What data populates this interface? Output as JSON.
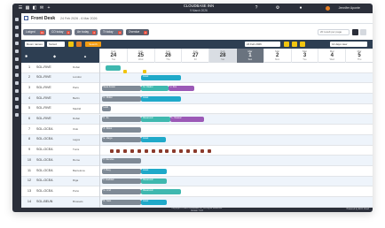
{
  "app": {
    "title": "CLOUDBASE INN",
    "subtitle": "9 March 2026",
    "user": "Jennifer Aponte"
  },
  "header": {
    "title": "Front Desk",
    "date_range": "24 Feb 2026 - 6 Mar 2026"
  },
  "filter_chips": [
    {
      "label": "Lodged",
      "count": "31",
      "dark": false
    },
    {
      "label": "CO today",
      "count": "3",
      "dark": false
    },
    {
      "label": "Arr today",
      "count": "4",
      "dark": false
    },
    {
      "label": "Tt today",
      "count": "3",
      "dark": false
    },
    {
      "label": "Overdue",
      "count": "2",
      "dark": true
    }
  ],
  "search_room_placeholder": "20 result per page",
  "toolbar": {
    "room_select": "Room names",
    "type_select": "Sorted",
    "search_button": "Search",
    "date_value": "24 Feb 2026",
    "days_select": "14 days view"
  },
  "grid_header": {
    "col_room": "#",
    "col_name": "",
    "col_type": ""
  },
  "days": [
    {
      "month": "Feb",
      "day": "24",
      "weekday": "Tue",
      "weekend": false,
      "today": false
    },
    {
      "month": "Feb",
      "day": "25",
      "weekday": "Wed",
      "weekend": false,
      "today": false
    },
    {
      "month": "Feb",
      "day": "26",
      "weekday": "Thu",
      "weekend": false,
      "today": false
    },
    {
      "month": "Feb",
      "day": "27",
      "weekday": "Fri",
      "weekend": false,
      "today": false
    },
    {
      "month": "Feb",
      "day": "28",
      "weekday": "Sat",
      "weekend": true,
      "today": false
    },
    {
      "month": "Mar",
      "day": "1",
      "weekday": "Sun",
      "weekend": true,
      "today": true
    },
    {
      "month": "Mar",
      "day": "2",
      "weekday": "Mon",
      "weekend": false,
      "today": false
    },
    {
      "month": "Mar",
      "day": "3",
      "weekday": "Tue",
      "weekend": false,
      "today": false
    },
    {
      "month": "Mar",
      "day": "4",
      "weekday": "Wed",
      "weekend": false,
      "today": false
    },
    {
      "month": "Mar",
      "day": "5",
      "weekday": "Thu",
      "weekend": false,
      "today": false
    }
  ],
  "rooms": [
    {
      "num": "1",
      "name": "SGL-RIVE",
      "type": "Dubai"
    },
    {
      "num": "2",
      "name": "SGL-RIVE",
      "type": "London"
    },
    {
      "num": "3",
      "name": "SGL-RIVE",
      "type": "Paris"
    },
    {
      "num": "4",
      "name": "SGL-RIVE",
      "type": "Berlin"
    },
    {
      "num": "5",
      "name": "SGL-RIVE",
      "type": "Madrid"
    },
    {
      "num": "6",
      "name": "SGL-RIVE",
      "type": "Dubai"
    },
    {
      "num": "7",
      "name": "SGL-OCEA",
      "type": "Oslo"
    },
    {
      "num": "8",
      "name": "SGL-OCEA",
      "type": "Lagos"
    },
    {
      "num": "9",
      "name": "SGL-OCEA",
      "type": "Tunis"
    },
    {
      "num": "10",
      "name": "SGL-OCEA",
      "type": "Rome"
    },
    {
      "num": "11",
      "name": "SGL-OCEA",
      "type": "Barcelona"
    },
    {
      "num": "12",
      "name": "SGL-OCEA",
      "type": "Riga"
    },
    {
      "num": "13",
      "name": "SGL-OCEA",
      "type": "Porto"
    },
    {
      "num": "14",
      "name": "SGL-BEUN",
      "type": "Brussels"
    }
  ],
  "bookings": [
    {
      "room": 0,
      "start": 0.2,
      "len": 0.55,
      "color": "teal",
      "label": ""
    },
    {
      "room": 1,
      "start": 1.5,
      "len": 1.45,
      "color": "cyan",
      "label": "Hotel"
    },
    {
      "room": 2,
      "start": 0.05,
      "len": 1.45,
      "color": "gray",
      "label": "Sara Foster"
    },
    {
      "room": 2,
      "start": 1.5,
      "len": 1.0,
      "color": "teal",
      "label": "M. Okafor"
    },
    {
      "room": 2,
      "start": 2.5,
      "len": 0.95,
      "color": "purple",
      "label": "J. Kim"
    },
    {
      "room": 3,
      "start": 0.05,
      "len": 1.45,
      "color": "gray",
      "label": "D. Müller"
    },
    {
      "room": 3,
      "start": 1.5,
      "len": 1.45,
      "color": "cyan",
      "label": "Hotel"
    },
    {
      "room": 4,
      "start": 0.05,
      "len": 0.35,
      "color": "gray",
      "label": "Hold"
    },
    {
      "room": 5,
      "start": 0.05,
      "len": 1.45,
      "color": "gray",
      "label": "K. Ito"
    },
    {
      "room": 5,
      "start": 1.5,
      "len": 1.05,
      "color": "teal",
      "label": "Reserved"
    },
    {
      "room": 5,
      "start": 2.55,
      "len": 1.25,
      "color": "purple",
      "label": "L. Nassar"
    },
    {
      "room": 6,
      "start": 0.05,
      "len": 1.45,
      "color": "gray",
      "label": "A. Rossi"
    },
    {
      "room": 7,
      "start": 0.05,
      "len": 1.45,
      "color": "gray",
      "label": "E. Varga"
    },
    {
      "room": 7,
      "start": 1.5,
      "len": 0.9,
      "color": "cyan",
      "label": "Hotel"
    },
    {
      "room": 9,
      "start": 0.05,
      "len": 1.45,
      "color": "gray",
      "label": "P. Mendes"
    },
    {
      "room": 10,
      "start": 0.05,
      "len": 1.45,
      "color": "gray",
      "label": "T. Berg"
    },
    {
      "room": 10,
      "start": 1.5,
      "len": 0.95,
      "color": "cyan",
      "label": "Hotel"
    },
    {
      "room": 11,
      "start": 0.05,
      "len": 1.45,
      "color": "gray",
      "label": "F. Haddad"
    },
    {
      "room": 11,
      "start": 1.5,
      "len": 0.95,
      "color": "teal",
      "label": "Reserved"
    },
    {
      "room": 12,
      "start": 0.05,
      "len": 1.45,
      "color": "gray",
      "label": "G. Lind"
    },
    {
      "room": 12,
      "start": 1.5,
      "len": 1.45,
      "color": "teal",
      "label": "Reserved"
    },
    {
      "room": 13,
      "start": 0.05,
      "len": 1.45,
      "color": "gray",
      "label": "R. Sato"
    },
    {
      "room": 13,
      "start": 1.5,
      "len": 0.95,
      "color": "cyan",
      "label": "Hotel"
    }
  ],
  "blocks_row1": [
    0.85,
    1.55
  ],
  "blocks_row9": [
    0.1,
    0.4,
    0.7,
    1.0,
    1.3,
    1.6,
    1.9,
    2.2,
    2.5,
    2.8,
    3.1,
    3.4,
    3.7,
    4.0,
    4.3
  ],
  "footer": {
    "copyright": "Copyright © 2026 Cloudbase Inn. All Rights Reserved.",
    "version": "Version 7.2.0",
    "powered": "Powered by ECO Cloud"
  }
}
